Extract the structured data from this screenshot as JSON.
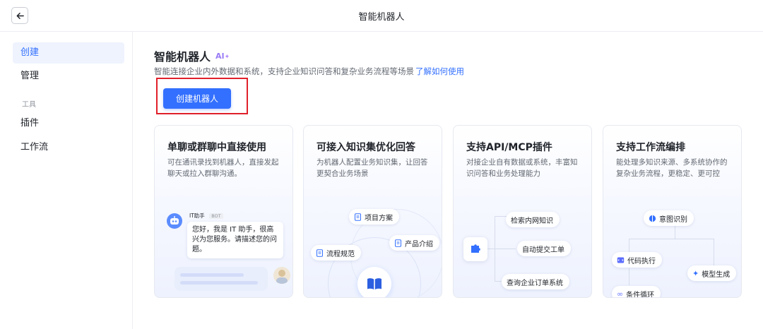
{
  "header": {
    "title": "智能机器人"
  },
  "sidebar": {
    "items": [
      {
        "label": "创建",
        "active": true
      },
      {
        "label": "管理",
        "active": false
      }
    ],
    "section_label": "工具",
    "tool_items": [
      {
        "label": "插件"
      },
      {
        "label": "工作流"
      }
    ]
  },
  "main": {
    "title": "智能机器人",
    "ai_badge": "AI",
    "description": "智能连接企业内外数据和系统，支持企业知识问答和复杂业务流程等场景",
    "learn_link": "了解如何使用",
    "create_button": "创建机器人"
  },
  "cards": [
    {
      "title": "单聊或群聊中直接使用",
      "desc": "可在通讯录找到机器人，直接发起聊天或拉入群聊沟通。",
      "bot_name": "IT助手",
      "bot_tag": "BOT",
      "bot_message": "您好，我是 IT 助手，很高兴为您服务。请描述您的问题。"
    },
    {
      "title": "可接入知识集优化回答",
      "desc": "为机器人配置业务知识集，让回答更契合业务场景",
      "chips": [
        "项目方案",
        "产品介绍",
        "流程规范"
      ]
    },
    {
      "title": "支持API/MCP插件",
      "desc": "对接企业自有数据或系统，丰富知识问答和业务处理能力",
      "chips": [
        "检索内网知识",
        "自动提交工单",
        "查询企业订单系统"
      ]
    },
    {
      "title": "支持工作流编排",
      "desc": "能处理多知识来源、多系统协作的复杂业务流程，更稳定、更可控",
      "chips": [
        "意图识别",
        "代码执行",
        "模型生成",
        "条件循环"
      ]
    }
  ],
  "colors": {
    "accent": "#3370ff",
    "highlight": "#e0202a",
    "active_bg": "#eef3fe"
  }
}
